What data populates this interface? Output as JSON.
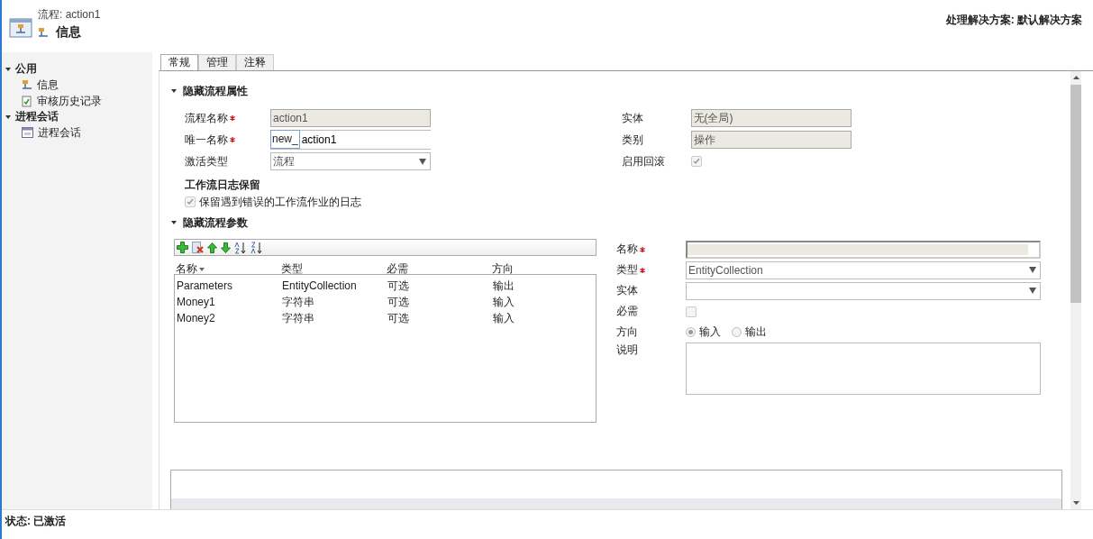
{
  "header": {
    "entity_label": "流程: action1",
    "title": "信息",
    "solution": "处理解决方案: 默认解决方案"
  },
  "sidebar": {
    "groups": [
      {
        "label": "公用",
        "expanded": true,
        "items": [
          {
            "label": "信息",
            "kind": "flow"
          },
          {
            "label": "审核历史记录",
            "kind": "audit"
          }
        ]
      },
      {
        "label": "进程会话",
        "expanded": true,
        "items": [
          {
            "label": "进程会话",
            "kind": "session"
          }
        ]
      }
    ]
  },
  "tabs": [
    {
      "label": "常规",
      "selected": true
    },
    {
      "label": "管理",
      "selected": false
    },
    {
      "label": "注释",
      "selected": false
    }
  ],
  "properties": {
    "label": "隐藏流程属性",
    "expanded": true,
    "left_fields": [
      {
        "label": "流程名称",
        "required": true,
        "kind": "readonly",
        "value": "action1"
      },
      {
        "label": "唯一名称",
        "required": true,
        "kind": "prefixed",
        "prefix": "new_",
        "value": "action1"
      },
      {
        "label": "激活类型",
        "required": false,
        "kind": "select",
        "value": "流程"
      }
    ],
    "right_fields": [
      {
        "label": "实体",
        "kind": "readonly",
        "value": "无(全局)"
      },
      {
        "label": "类别",
        "kind": "readonly",
        "value": "操作"
      },
      {
        "label": "启用回滚",
        "kind": "checkbox",
        "checked": true
      }
    ],
    "log_heading": "工作流日志保留",
    "log_option": {
      "label": "保留遇到错误的工作流作业的日志",
      "checked": true
    }
  },
  "parameters": {
    "label": "隐藏流程参数",
    "expanded": true,
    "columns": [
      {
        "label": "名称",
        "sorted": true
      },
      {
        "label": "类型",
        "sorted": false
      },
      {
        "label": "必需",
        "sorted": false
      },
      {
        "label": "方向",
        "sorted": false
      }
    ],
    "rows": [
      [
        "Parameters",
        "EntityCollection",
        "可选",
        "输出"
      ],
      [
        "Money1",
        "字符串",
        "可选",
        "输入"
      ],
      [
        "Money2",
        "字符串",
        "可选",
        "输入"
      ]
    ],
    "form": [
      {
        "label": "名称",
        "required": true,
        "kind": "text"
      },
      {
        "label": "类型",
        "required": true,
        "kind": "select",
        "value": "EntityCollection"
      },
      {
        "label": "实体",
        "required": false,
        "kind": "select"
      },
      {
        "label": "必需",
        "required": false,
        "kind": "checkbox",
        "checked": false
      },
      {
        "label": "方向",
        "required": false,
        "kind": "radio",
        "options": [
          {
            "label": "输入",
            "selected": true
          },
          {
            "label": "输出",
            "selected": false
          }
        ]
      },
      {
        "label": "说明",
        "required": false,
        "kind": "textarea"
      }
    ]
  },
  "status_bar": "状态: 已激活"
}
